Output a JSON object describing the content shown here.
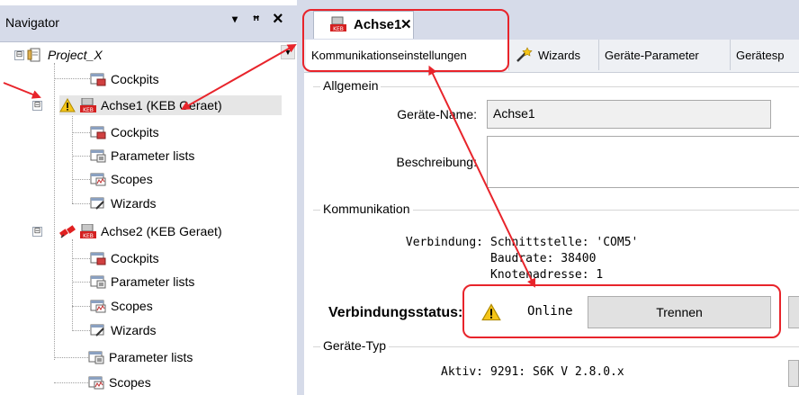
{
  "navigator": {
    "title": "Navigator",
    "dropdown_glyph": "▾",
    "pin_glyph": "ꟸ",
    "close_glyph": "×",
    "items": [
      {
        "label": "Project_X",
        "italic": true,
        "icon": "project-icon"
      },
      {
        "label": "Cockpits",
        "icon": "cockpit-icon"
      },
      {
        "label": "Achse1 (KEB Geraet)",
        "icon": "keb-device-icon",
        "status_icon": "warning-icon"
      },
      {
        "label": "Cockpits",
        "icon": "cockpit-icon"
      },
      {
        "label": "Parameter lists",
        "icon": "parameter-list-icon"
      },
      {
        "label": "Scopes",
        "icon": "scope-icon"
      },
      {
        "label": "Wizards",
        "icon": "wizard-icon"
      },
      {
        "label": "Achse2 (KEB Geraet)",
        "icon": "keb-device-icon",
        "status_icon": "disconnected-plug-icon"
      },
      {
        "label": "Cockpits",
        "icon": "cockpit-icon"
      },
      {
        "label": "Parameter lists",
        "icon": "parameter-list-icon"
      },
      {
        "label": "Scopes",
        "icon": "scope-icon"
      },
      {
        "label": "Wizards",
        "icon": "wizard-icon"
      },
      {
        "label": "Parameter lists",
        "icon": "parameter-list-icon"
      },
      {
        "label": "Scopes",
        "icon": "scope-icon"
      }
    ],
    "expanders": [
      "⊟",
      "⊟",
      "⊟"
    ]
  },
  "editor": {
    "doc_tab": {
      "title": "Achse1",
      "close": "✕",
      "icon": "keb-device-icon"
    },
    "tabs": [
      {
        "label": "Kommunikationseinstellungen"
      },
      {
        "label": "Wizards",
        "icon": "wand-icon"
      },
      {
        "label": "Geräte-Parameter"
      },
      {
        "label": "Gerätesp"
      }
    ],
    "allgemein": {
      "title": "Allgemein",
      "name_label": "Geräte-Name:",
      "name_value": "Achse1",
      "desc_label": "Beschreibung:",
      "desc_value": ""
    },
    "kommunikation": {
      "title": "Kommunikation",
      "verbindung_label": "Verbindung:",
      "lines": [
        "Schnittstelle: 'COM5'",
        "Baudrate: 38400",
        "Knotenadresse: 1"
      ]
    },
    "status": {
      "label": "Verbindungsstatus:",
      "value": "Online",
      "button": "Trennen"
    },
    "geraetetyp": {
      "title": "Geräte-Typ",
      "aktiv_label": "Aktiv:",
      "aktiv_value": "9291: S6K V 2.8.0.x"
    }
  },
  "colors": {
    "highlight": "#e8242b",
    "header": "#d6dbe9"
  }
}
